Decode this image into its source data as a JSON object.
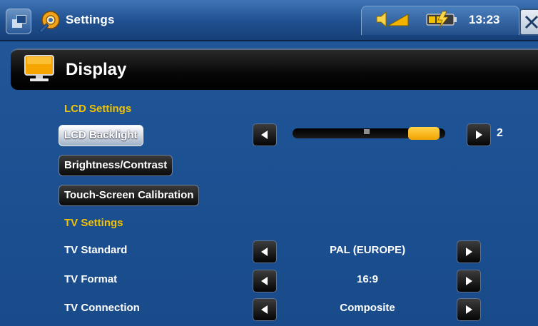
{
  "titlebar": {
    "app_title": "Settings",
    "clock": "13:23",
    "icons": [
      "menu-icon",
      "settings-icon",
      "volume-icon",
      "battery-icon",
      "close-icon"
    ]
  },
  "page": {
    "title": "Display"
  },
  "lcd_section": {
    "heading": "LCD Settings",
    "backlight_label": "LCD Backlight",
    "backlight_value": "2",
    "backlight_level": 0.95,
    "brightness_label": "Brightness/Contrast",
    "calibration_label": "Touch-Screen Calibration"
  },
  "tv_section": {
    "heading": "TV Settings",
    "rows": [
      {
        "label": "TV Standard",
        "value": "PAL (EUROPE)"
      },
      {
        "label": "TV Format",
        "value": "16:9"
      },
      {
        "label": "TV Connection",
        "value": "Composite"
      }
    ]
  },
  "colors": {
    "background": "#1d5294",
    "section_heading": "#f2c200",
    "slider_fill": "#f3a300"
  }
}
